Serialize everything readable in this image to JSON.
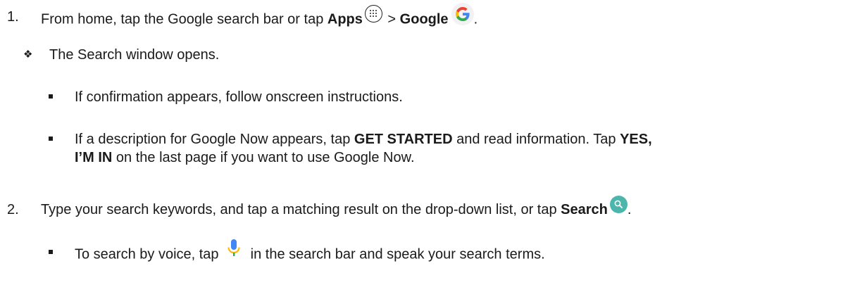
{
  "step1": {
    "number": "1.",
    "text_before": "From home, tap the Google search bar or tap ",
    "apps_label": "Apps",
    "separator": " > ",
    "google_label": "Google",
    "end": "."
  },
  "step1_result": "The Search window opens.",
  "step1_bullets": {
    "confirmation": "If confirmation appears, follow onscreen instructions.",
    "desc_before": "If a description for Google Now appears, tap ",
    "get_started": "GET STARTED",
    "desc_middle": " and read information. Tap ",
    "yes_label_part1": "YES,",
    "yes_label_part2": "I’M IN",
    "desc_end": " on the last page if you want to use Google Now."
  },
  "step2": {
    "number": "2.",
    "text_before": "Type your search keywords, and tap a matching result on the drop-down list, or tap ",
    "search_label": "Search",
    "end": "."
  },
  "step2_bullets": {
    "voice_before": "To search by voice, tap ",
    "voice_after": " in the search bar and speak your search terms."
  },
  "icons": {
    "apps": "apps-icon",
    "google": "google-icon",
    "search": "search-icon",
    "mic": "mic-icon",
    "diamond_bullet": "diamond-bullet-icon",
    "square_bullet": "square-bullet-icon"
  },
  "colors": {
    "text": "#1a1a1a",
    "search_teal": "#4db6ac",
    "google_blue": "#4285f4",
    "google_red": "#ea4335",
    "google_yellow": "#fbbc05",
    "google_green": "#34a853"
  }
}
